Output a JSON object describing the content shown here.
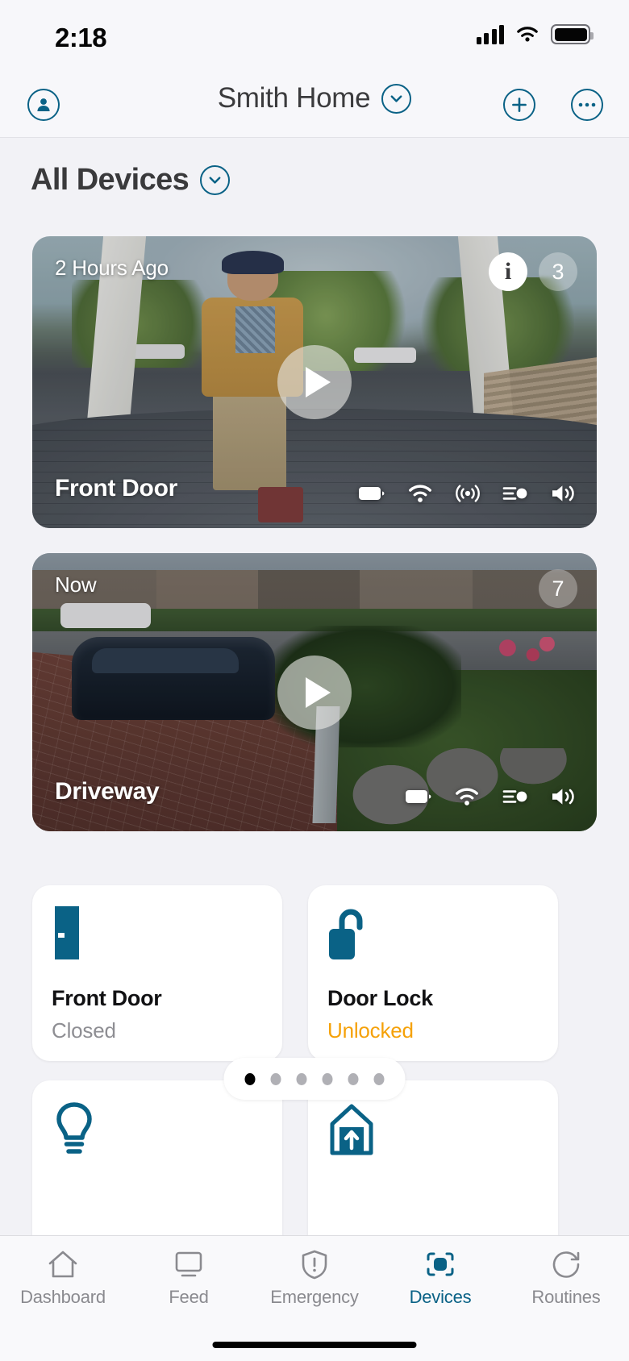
{
  "status_bar": {
    "time": "2:18",
    "cellular_icon": "cellular-bars-icon",
    "wifi_icon": "wifi-icon",
    "battery_icon": "battery-full-icon"
  },
  "nav_bar": {
    "profile_icon": "person-circle-icon",
    "title": "Smith Home",
    "title_chevron_icon": "chevron-down-circle-icon",
    "add_icon": "plus-circle-icon",
    "more_icon": "ellipsis-circle-icon"
  },
  "section": {
    "title": "All Devices",
    "chevron_icon": "chevron-down-circle-icon"
  },
  "cameras": [
    {
      "name": "Front Door",
      "timestamp": "2 Hours Ago",
      "info_badge": "i",
      "event_count": "3",
      "play_icon": "play-icon",
      "status_icons": [
        "battery-icon",
        "wifi-icon",
        "motion-sensor-icon",
        "spotlight-icon",
        "speaker-icon"
      ]
    },
    {
      "name": "Driveway",
      "timestamp": "Now",
      "event_count": "7",
      "play_icon": "play-icon",
      "status_icons": [
        "battery-icon",
        "wifi-icon",
        "spotlight-icon",
        "speaker-icon"
      ]
    }
  ],
  "tiles": [
    {
      "icon": "door-icon",
      "name": "Front Door",
      "state": "Closed",
      "state_style": "muted"
    },
    {
      "icon": "unlocked-lock-icon",
      "name": "Door Lock",
      "state": "Unlocked",
      "state_style": "warn"
    },
    {
      "icon": "lightbulb-icon",
      "name": "",
      "state": "",
      "state_style": "muted"
    },
    {
      "icon": "garage-door-icon",
      "name": "",
      "state": "",
      "state_style": "muted"
    }
  ],
  "pagination": {
    "total": 6,
    "active_index": 0
  },
  "tab_bar": {
    "active_index": 3,
    "items": [
      {
        "label": "Dashboard",
        "icon": "home-icon"
      },
      {
        "label": "Feed",
        "icon": "monitor-icon"
      },
      {
        "label": "Emergency",
        "icon": "shield-alert-icon"
      },
      {
        "label": "Devices",
        "icon": "devices-icon"
      },
      {
        "label": "Routines",
        "icon": "clock-arrow-icon"
      }
    ]
  },
  "colors": {
    "accent": "#0a6286",
    "warning": "#f5a108",
    "muted": "#8e8e93",
    "background": "#f2f2f6"
  }
}
